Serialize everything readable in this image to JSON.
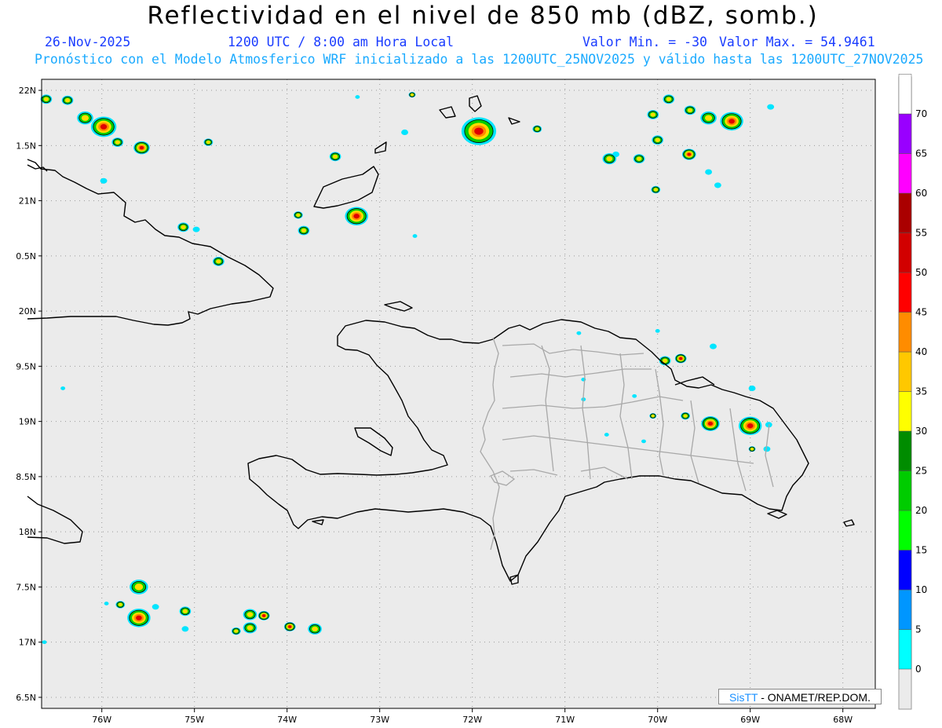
{
  "header": {
    "title": "Reflectividad en el nivel de 850 mb (dBZ, somb.)",
    "date": "26-Nov-2025",
    "time": "1200 UTC / 8:00 am Hora Local",
    "min_label": "Valor Min. = -30",
    "max_label": "Valor Max. = 54.9461",
    "forecast": "Pronóstico con el Modelo Atmosferico WRF inicializado a las 1200UTC_25NOV2025 y válido hasta las  1200UTC_27NOV2025"
  },
  "credit": {
    "logo": "SisTT",
    "text": " - ONAMET/REP.DOM."
  },
  "map": {
    "lat_labels": [
      "22N",
      "1.5N",
      "21N",
      "0.5N",
      "20N",
      "9.5N",
      "19N",
      "8.5N",
      "18N",
      "7.5N",
      "17N",
      "6.5N"
    ],
    "lon_labels": [
      "76W",
      "75W",
      "74W",
      "73W",
      "72W",
      "71W",
      "70W",
      "69W",
      "68W"
    ],
    "lon_range": [
      -76.65,
      -67.65
    ],
    "lat_range": [
      16.4,
      22.1
    ]
  },
  "colorbar": {
    "ticks": [
      "0",
      "5",
      "10",
      "15",
      "20",
      "25",
      "30",
      "35",
      "40",
      "45",
      "50",
      "55",
      "60",
      "65",
      "70"
    ],
    "colors": [
      "#00ffff",
      "#0096ff",
      "#0000ff",
      "#00ff00",
      "#00cc00",
      "#008c00",
      "#ffff00",
      "#ffc800",
      "#ff8c00",
      "#ff0000",
      "#d20000",
      "#aa0000",
      "#ff00ff",
      "#9900ff",
      "#ffffff"
    ]
  },
  "cells": [
    {
      "lon": -76.6,
      "lat": 21.92,
      "r": 0.05,
      "lvl": 2
    },
    {
      "lon": -76.37,
      "lat": 21.91,
      "r": 0.05,
      "lvl": 2
    },
    {
      "lon": -76.18,
      "lat": 21.75,
      "r": 0.07,
      "lvl": 2
    },
    {
      "lon": -75.98,
      "lat": 21.67,
      "r": 0.11,
      "lvl": 3
    },
    {
      "lon": -75.83,
      "lat": 21.53,
      "r": 0.05,
      "lvl": 2
    },
    {
      "lon": -75.57,
      "lat": 21.48,
      "r": 0.07,
      "lvl": 3
    },
    {
      "lon": -74.85,
      "lat": 21.53,
      "r": 0.04,
      "lvl": 2
    },
    {
      "lon": -75.98,
      "lat": 21.18,
      "r": 0.03,
      "lvl": 1
    },
    {
      "lon": -75.12,
      "lat": 20.76,
      "r": 0.05,
      "lvl": 2
    },
    {
      "lon": -74.98,
      "lat": 20.74,
      "r": 0.03,
      "lvl": 1
    },
    {
      "lon": -74.74,
      "lat": 20.45,
      "r": 0.05,
      "lvl": 2
    },
    {
      "lon": -73.48,
      "lat": 21.4,
      "r": 0.05,
      "lvl": 2
    },
    {
      "lon": -73.24,
      "lat": 21.94,
      "r": 0.02,
      "lvl": 1
    },
    {
      "lon": -73.88,
      "lat": 20.87,
      "r": 0.04,
      "lvl": 2
    },
    {
      "lon": -73.82,
      "lat": 20.73,
      "r": 0.05,
      "lvl": 2
    },
    {
      "lon": -73.25,
      "lat": 20.86,
      "r": 0.1,
      "lvl": 3
    },
    {
      "lon": -72.65,
      "lat": 21.96,
      "r": 0.03,
      "lvl": 2
    },
    {
      "lon": -72.73,
      "lat": 21.62,
      "r": 0.03,
      "lvl": 1
    },
    {
      "lon": -72.62,
      "lat": 20.68,
      "r": 0.02,
      "lvl": 1
    },
    {
      "lon": -71.93,
      "lat": 21.63,
      "r": 0.15,
      "lvl": 3
    },
    {
      "lon": -71.3,
      "lat": 21.65,
      "r": 0.04,
      "lvl": 2
    },
    {
      "lon": -70.05,
      "lat": 21.78,
      "r": 0.05,
      "lvl": 2
    },
    {
      "lon": -69.88,
      "lat": 21.92,
      "r": 0.05,
      "lvl": 2
    },
    {
      "lon": -69.65,
      "lat": 21.82,
      "r": 0.05,
      "lvl": 2
    },
    {
      "lon": -69.45,
      "lat": 21.75,
      "r": 0.07,
      "lvl": 2
    },
    {
      "lon": -69.2,
      "lat": 21.72,
      "r": 0.1,
      "lvl": 3
    },
    {
      "lon": -68.78,
      "lat": 21.85,
      "r": 0.03,
      "lvl": 1
    },
    {
      "lon": -70.0,
      "lat": 21.55,
      "r": 0.05,
      "lvl": 2
    },
    {
      "lon": -70.2,
      "lat": 21.38,
      "r": 0.05,
      "lvl": 2
    },
    {
      "lon": -70.45,
      "lat": 21.42,
      "r": 0.03,
      "lvl": 1
    },
    {
      "lon": -70.52,
      "lat": 21.38,
      "r": 0.06,
      "lvl": 2
    },
    {
      "lon": -69.66,
      "lat": 21.42,
      "r": 0.06,
      "lvl": 3
    },
    {
      "lon": -69.45,
      "lat": 21.26,
      "r": 0.03,
      "lvl": 1
    },
    {
      "lon": -69.35,
      "lat": 21.14,
      "r": 0.03,
      "lvl": 1
    },
    {
      "lon": -70.02,
      "lat": 21.1,
      "r": 0.04,
      "lvl": 2
    },
    {
      "lon": -70.85,
      "lat": 19.8,
      "r": 0.02,
      "lvl": 1
    },
    {
      "lon": -70.0,
      "lat": 19.82,
      "r": 0.02,
      "lvl": 1
    },
    {
      "lon": -69.92,
      "lat": 19.55,
      "r": 0.05,
      "lvl": 2
    },
    {
      "lon": -69.75,
      "lat": 19.57,
      "r": 0.05,
      "lvl": 3
    },
    {
      "lon": -69.4,
      "lat": 19.68,
      "r": 0.03,
      "lvl": 1
    },
    {
      "lon": -70.8,
      "lat": 19.38,
      "r": 0.02,
      "lvl": 1
    },
    {
      "lon": -70.8,
      "lat": 19.2,
      "r": 0.02,
      "lvl": 1
    },
    {
      "lon": -70.25,
      "lat": 19.23,
      "r": 0.02,
      "lvl": 1
    },
    {
      "lon": -68.98,
      "lat": 19.3,
      "r": 0.03,
      "lvl": 1
    },
    {
      "lon": -69.7,
      "lat": 19.05,
      "r": 0.04,
      "lvl": 2
    },
    {
      "lon": -69.43,
      "lat": 18.98,
      "r": 0.08,
      "lvl": 3
    },
    {
      "lon": -69.0,
      "lat": 18.96,
      "r": 0.1,
      "lvl": 3
    },
    {
      "lon": -70.05,
      "lat": 19.05,
      "r": 0.03,
      "lvl": 2
    },
    {
      "lon": -68.8,
      "lat": 18.97,
      "r": 0.03,
      "lvl": 1
    },
    {
      "lon": -70.55,
      "lat": 18.88,
      "r": 0.02,
      "lvl": 1
    },
    {
      "lon": -70.15,
      "lat": 18.82,
      "r": 0.02,
      "lvl": 1
    },
    {
      "lon": -68.98,
      "lat": 18.75,
      "r": 0.03,
      "lvl": 2
    },
    {
      "lon": -68.82,
      "lat": 18.75,
      "r": 0.03,
      "lvl": 1
    },
    {
      "lon": -76.42,
      "lat": 19.3,
      "r": 0.02,
      "lvl": 1
    },
    {
      "lon": -75.95,
      "lat": 17.35,
      "r": 0.02,
      "lvl": 1
    },
    {
      "lon": -75.6,
      "lat": 17.5,
      "r": 0.08,
      "lvl": 2
    },
    {
      "lon": -75.8,
      "lat": 17.34,
      "r": 0.04,
      "lvl": 2
    },
    {
      "lon": -75.6,
      "lat": 17.22,
      "r": 0.1,
      "lvl": 3
    },
    {
      "lon": -75.42,
      "lat": 17.32,
      "r": 0.03,
      "lvl": 1
    },
    {
      "lon": -75.1,
      "lat": 17.28,
      "r": 0.05,
      "lvl": 2
    },
    {
      "lon": -75.1,
      "lat": 17.12,
      "r": 0.03,
      "lvl": 1
    },
    {
      "lon": -74.4,
      "lat": 17.25,
      "r": 0.06,
      "lvl": 2
    },
    {
      "lon": -74.25,
      "lat": 17.24,
      "r": 0.05,
      "lvl": 3
    },
    {
      "lon": -74.4,
      "lat": 17.13,
      "r": 0.06,
      "lvl": 2
    },
    {
      "lon": -74.55,
      "lat": 17.1,
      "r": 0.04,
      "lvl": 2
    },
    {
      "lon": -73.97,
      "lat": 17.14,
      "r": 0.05,
      "lvl": 3
    },
    {
      "lon": -73.7,
      "lat": 17.12,
      "r": 0.06,
      "lvl": 2
    },
    {
      "lon": -76.62,
      "lat": 17.0,
      "r": 0.02,
      "lvl": 1
    }
  ]
}
